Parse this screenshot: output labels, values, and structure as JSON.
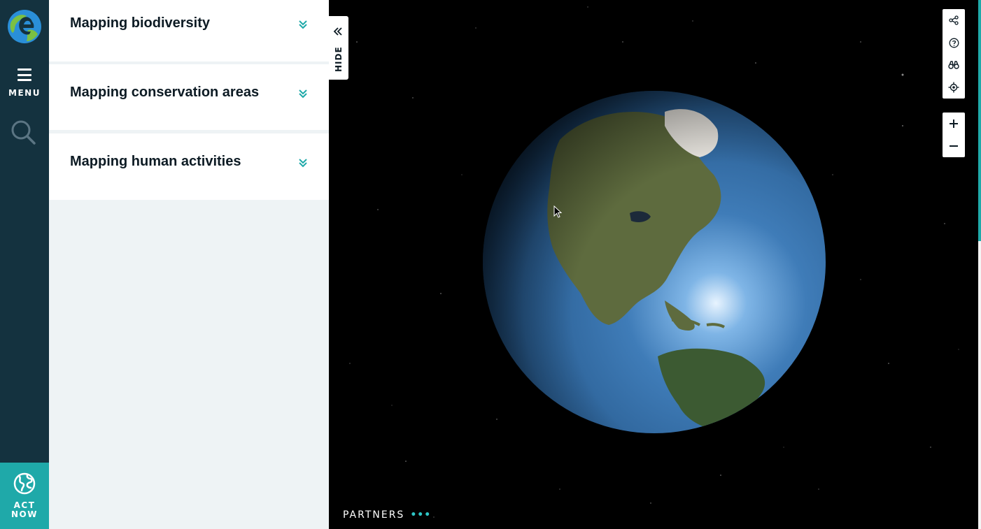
{
  "nav": {
    "menu_label": "MENU",
    "act_now_label": "ACT NOW",
    "logo_icon": "earth-e-logo-icon",
    "search_icon": "search-icon",
    "act_icon": "globe-icon"
  },
  "sidebar": {
    "sections": [
      {
        "title": "Mapping biodiversity",
        "icon": "double-chevron-down-icon"
      },
      {
        "title": "Mapping conservation areas",
        "icon": "double-chevron-down-icon"
      },
      {
        "title": "Mapping human activities",
        "icon": "double-chevron-down-icon"
      }
    ],
    "hide_label": "HIDE"
  },
  "map": {
    "partners_label": "PARTNERS",
    "partners_dots": "•••",
    "tools": [
      "share-icon",
      "help-icon",
      "binoculars-icon",
      "locate-icon"
    ],
    "zoom": [
      "zoom-in-icon",
      "zoom-out-icon"
    ]
  },
  "colors": {
    "rail": "#14323f",
    "accent": "#1fa9a9",
    "panel_bg": "#eef3f5",
    "text_dark": "#0d1b24"
  }
}
